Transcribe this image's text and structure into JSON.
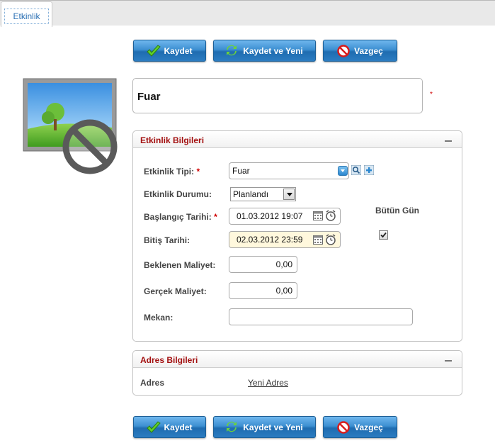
{
  "tab": {
    "label": "Etkinlik"
  },
  "toolbar": {
    "save": "Kaydet",
    "save_new": "Kaydet ve Yeni",
    "cancel": "Vazgeç"
  },
  "name_field": {
    "value": "Fuar",
    "required_mark": "*"
  },
  "event_info": {
    "title": "Etkinlik Bilgileri",
    "type_label": "Etkinlik Tipi:",
    "type_value": "Fuar",
    "status_label": "Etkinlik Durumu:",
    "status_value": "Planlandı",
    "start_label": "Başlangıç Tarihi:",
    "start_value": "01.03.2012 19:07",
    "end_label": "Bitiş Tarihi:",
    "end_value": "02.03.2012 23:59",
    "all_day_label": "Bütün Gün",
    "all_day_checked": true,
    "expected_cost_label": "Beklenen Maliyet:",
    "expected_cost_value": "0,00",
    "actual_cost_label": "Gerçek Maliyet:",
    "actual_cost_value": "0,00",
    "venue_label": "Mekan:",
    "venue_value": "",
    "required_mark": "*"
  },
  "address_info": {
    "title": "Adres Bilgileri",
    "address_label": "Adres",
    "new_address_link": "Yeni Adres"
  },
  "colors": {
    "accent": "#2b7cc1",
    "section_title": "#a31010",
    "required": "#d00000"
  },
  "icons": [
    "check-icon",
    "refresh-icon",
    "no-entry-icon",
    "image-placeholder-icon",
    "dropdown-icon",
    "search-icon",
    "add-icon",
    "calendar-icon",
    "clock-icon",
    "minus-icon"
  ]
}
